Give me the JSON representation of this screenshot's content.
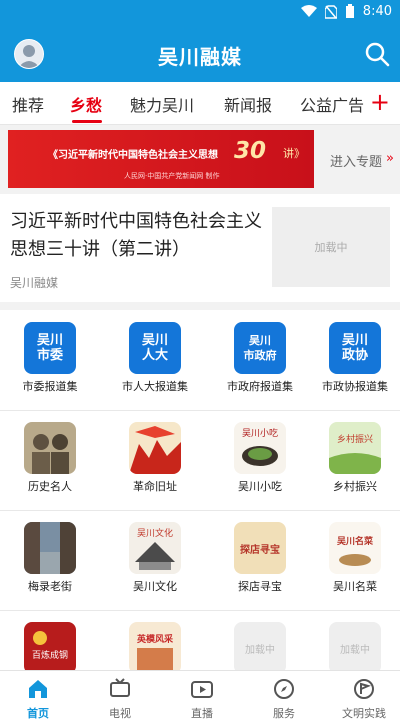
{
  "status": {
    "time": "8:40"
  },
  "header": {
    "title": "吴川融媒"
  },
  "tabs": [
    {
      "label": "推荐"
    },
    {
      "label": "乡愁",
      "active": true
    },
    {
      "label": "魅力吴川"
    },
    {
      "label": "新闻报"
    },
    {
      "label": "公益广告"
    }
  ],
  "banner": {
    "title": "《习近平新时代中国特色社会主义思想",
    "num": "30",
    "suffix": "讲》",
    "credit": "人民网·中国共产党新闻网 制作",
    "enter_label": "进入专题"
  },
  "article": {
    "headline": "习近平新时代中国特色社会主义思想三十讲（第二讲）",
    "source": "吴川融媒",
    "thumb_placeholder": "加载中"
  },
  "grid": [
    {
      "label": "市委报道集",
      "tile": "吴川\n市委"
    },
    {
      "label": "市人大报道集",
      "tile": "吴川\n人大"
    },
    {
      "label": "市政府报道集",
      "tile": "吴川\n市政府"
    },
    {
      "label": "市政协报道集",
      "tile": "吴川\n政协"
    },
    {
      "label": "历史名人"
    },
    {
      "label": "革命旧址"
    },
    {
      "label": "吴川小吃",
      "tile_text": "吴川小吃"
    },
    {
      "label": "乡村振兴",
      "tile_text": "乡村振兴"
    },
    {
      "label": "梅录老街"
    },
    {
      "label": "吴川文化",
      "tile_text": "吴川文化"
    },
    {
      "label": "探店寻宝",
      "tile_text": "探店寻宝"
    },
    {
      "label": "吴川名菜",
      "tile_text": "吴川名菜"
    },
    {
      "label": "",
      "tile_text": "百炼成钢"
    },
    {
      "label": "",
      "tile_text": "英模风采"
    },
    {
      "label": "",
      "tile_text": "加载中"
    },
    {
      "label": "",
      "tile_text": "加载中"
    }
  ],
  "bottom_nav": [
    {
      "label": "首页",
      "active": true
    },
    {
      "label": "电视"
    },
    {
      "label": "直播"
    },
    {
      "label": "服务"
    },
    {
      "label": "文明实践"
    }
  ],
  "colors": {
    "brand": "#1296db",
    "accent": "#e60012"
  }
}
